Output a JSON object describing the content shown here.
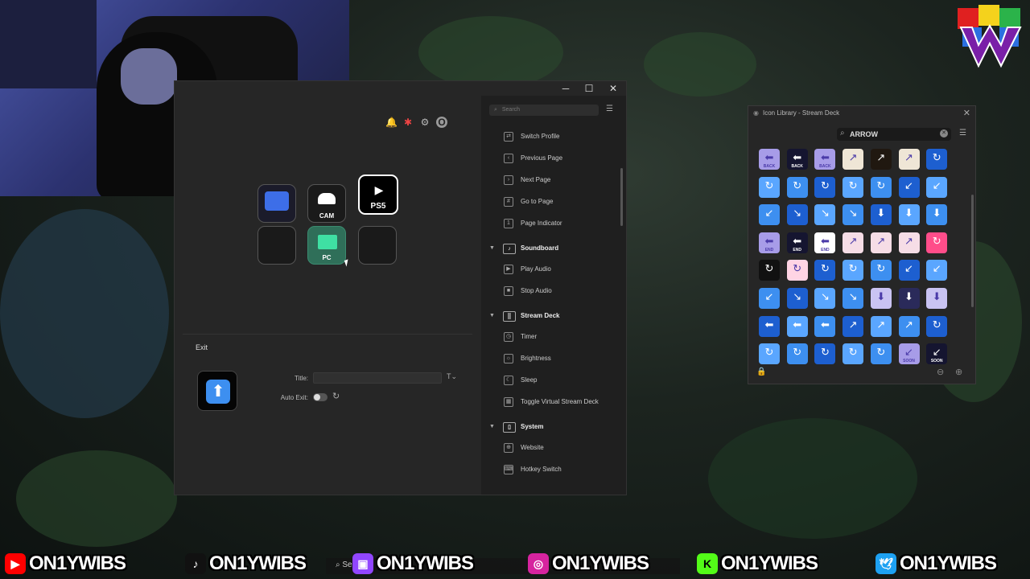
{
  "stream_deck": {
    "search_placeholder": "Search",
    "keys": [
      {
        "label": ""
      },
      {
        "label": "CAM"
      },
      {
        "label": "PS5"
      },
      {
        "label": ""
      },
      {
        "label": "PC"
      },
      {
        "label": ""
      }
    ],
    "inspector": {
      "action_title": "Exit",
      "title_label": "Title:",
      "title_value": "",
      "auto_exit_label": "Auto Exit:"
    },
    "actions": [
      {
        "type": "item",
        "label": "Switch Profile",
        "icon": "switch-icon"
      },
      {
        "type": "item",
        "label": "Previous Page",
        "icon": "prev-page-icon"
      },
      {
        "type": "item",
        "label": "Next Page",
        "icon": "next-page-icon"
      },
      {
        "type": "item",
        "label": "Go to Page",
        "icon": "grid-icon"
      },
      {
        "type": "item",
        "label": "Page Indicator",
        "icon": "indicator-icon"
      },
      {
        "type": "category",
        "label": "Soundboard",
        "icon": "speaker-icon"
      },
      {
        "type": "item",
        "label": "Play Audio",
        "icon": "play-icon"
      },
      {
        "type": "item",
        "label": "Stop Audio",
        "icon": "stop-icon"
      },
      {
        "type": "category",
        "label": "Stream Deck",
        "icon": "streamdeck-icon"
      },
      {
        "type": "item",
        "label": "Timer",
        "icon": "timer-icon"
      },
      {
        "type": "item",
        "label": "Brightness",
        "icon": "brightness-icon"
      },
      {
        "type": "item",
        "label": "Sleep",
        "icon": "sleep-icon"
      },
      {
        "type": "item",
        "label": "Toggle Virtual Stream Deck",
        "icon": "virtual-deck-icon"
      },
      {
        "type": "category",
        "label": "System",
        "icon": "system-icon"
      },
      {
        "type": "item",
        "label": "Website",
        "icon": "globe-icon"
      },
      {
        "type": "item",
        "label": "Hotkey Switch",
        "icon": "hotkey-icon"
      }
    ]
  },
  "icon_library": {
    "title": "Icon Library - Stream Deck",
    "search_value": "ARROW",
    "tiles": [
      [
        "BACK",
        "BACK",
        "BACK",
        "",
        "",
        "",
        ""
      ],
      [
        "",
        "",
        "",
        "",
        "",
        "",
        ""
      ],
      [
        "",
        "",
        "",
        "",
        "",
        "",
        ""
      ],
      [
        "END",
        "END",
        "END",
        "",
        "",
        "",
        ""
      ],
      [
        "",
        "",
        "",
        "",
        "",
        "",
        ""
      ],
      [
        "",
        "",
        "",
        "",
        "",
        "",
        ""
      ],
      [
        "",
        "",
        "",
        "",
        "",
        "",
        ""
      ],
      [
        "",
        "",
        "",
        "",
        "",
        "SOON",
        "SOON"
      ]
    ]
  },
  "social": [
    {
      "platform": "youtube",
      "handle": "ON1YWIBS",
      "color": "#ff0000",
      "icon": "youtube-icon"
    },
    {
      "platform": "tiktok",
      "handle": "ON1YWIBS",
      "color": "#111111",
      "icon": "tiktok-icon"
    },
    {
      "platform": "twitch",
      "handle": "ON1YWIBS",
      "color": "#9146ff",
      "icon": "twitch-icon"
    },
    {
      "platform": "instagram",
      "handle": "ON1YWIBS",
      "color": "#d6249f",
      "icon": "instagram-icon"
    },
    {
      "platform": "kick",
      "handle": "ON1YWIBS",
      "color": "#53fc18",
      "icon": "kick-icon"
    },
    {
      "platform": "twitter",
      "handle": "ON1YWIBS",
      "color": "#1da1f2",
      "icon": "twitter-icon"
    }
  ],
  "taskbar": {
    "search_label": "Search"
  }
}
